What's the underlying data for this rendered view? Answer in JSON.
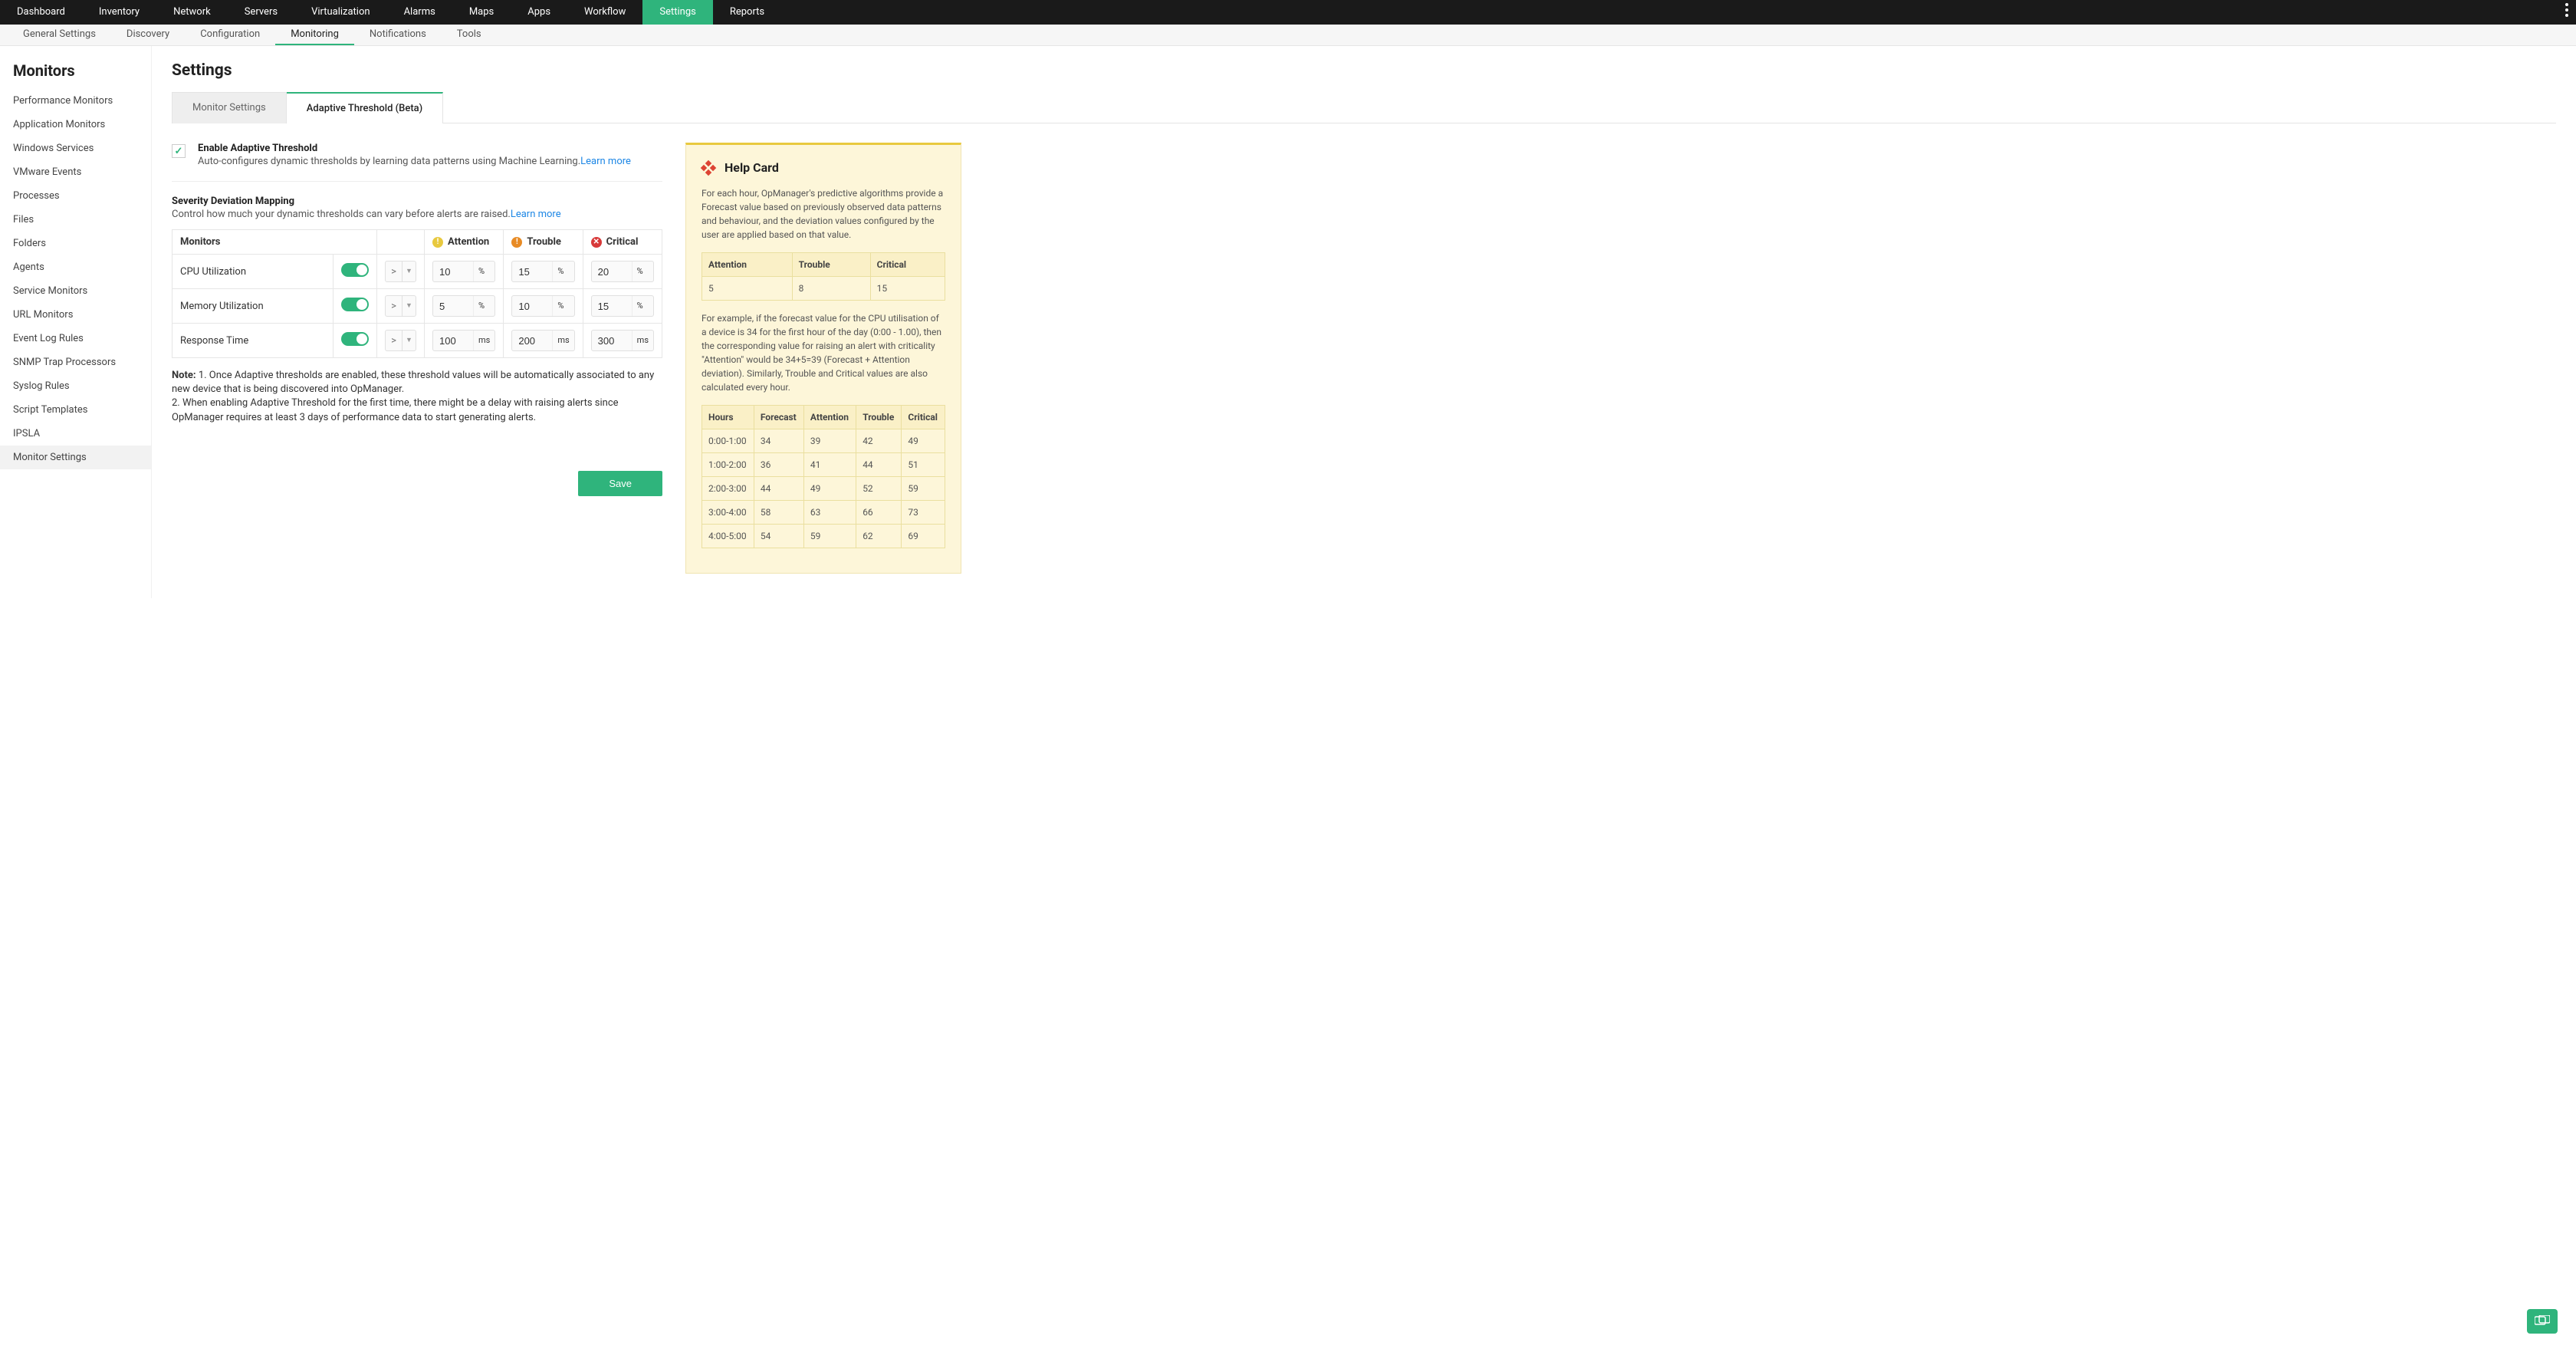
{
  "topnav": {
    "items": [
      "Dashboard",
      "Inventory",
      "Network",
      "Servers",
      "Virtualization",
      "Alarms",
      "Maps",
      "Apps",
      "Workflow",
      "Settings",
      "Reports"
    ],
    "active": "Settings"
  },
  "subnav": {
    "items": [
      "General Settings",
      "Discovery",
      "Configuration",
      "Monitoring",
      "Notifications",
      "Tools"
    ],
    "active": "Monitoring"
  },
  "sidebar": {
    "title": "Monitors",
    "items": [
      "Performance Monitors",
      "Application Monitors",
      "Windows Services",
      "VMware Events",
      "Processes",
      "Files",
      "Folders",
      "Agents",
      "Service Monitors",
      "URL Monitors",
      "Event Log Rules",
      "SNMP Trap Processors",
      "Syslog Rules",
      "Script Templates",
      "IPSLA",
      "Monitor Settings"
    ],
    "active": "Monitor Settings"
  },
  "page": {
    "title": "Settings",
    "tabs": [
      {
        "label": "Monitor Settings",
        "active": false
      },
      {
        "label": "Adaptive Threshold (Beta)",
        "active": true
      }
    ]
  },
  "enable": {
    "checked": true,
    "title": "Enable Adaptive Threshold",
    "desc": "Auto-configures dynamic thresholds by learning data patterns using Machine Learning.",
    "learn": "Learn more"
  },
  "severity": {
    "title": "Severity Deviation Mapping",
    "desc": "Control how much your dynamic thresholds can vary before alerts are raised.",
    "learn": "Learn more",
    "headers": {
      "monitors": "Monitors",
      "attention": "Attention",
      "trouble": "Trouble",
      "critical": "Critical"
    },
    "rows": [
      {
        "name": "CPU Utilization",
        "enabled": true,
        "op": ">",
        "attention": "10",
        "trouble": "15",
        "critical": "20",
        "unit": "%"
      },
      {
        "name": "Memory Utilization",
        "enabled": true,
        "op": ">",
        "attention": "5",
        "trouble": "10",
        "critical": "15",
        "unit": "%"
      },
      {
        "name": "Response Time",
        "enabled": true,
        "op": ">",
        "attention": "100",
        "trouble": "200",
        "critical": "300",
        "unit": "ms"
      }
    ]
  },
  "note": {
    "label": "Note:",
    "line1": "1. Once Adaptive thresholds are enabled, these threshold values will be automatically associated to any new device that is being discovered into OpManager.",
    "line2": "2. When enabling Adaptive Threshold for the first time, there might be a delay with raising alerts since OpManager requires at least 3 days of performance data to start generating alerts."
  },
  "save_label": "Save",
  "help": {
    "title": "Help Card",
    "para1": "For each hour, OpManager's predictive algorithms provide a Forecast value based on previously observed data patterns and behaviour, and the deviation values configured by the user are applied based on that value.",
    "sev_headers": {
      "attention": "Attention",
      "trouble": "Trouble",
      "critical": "Critical"
    },
    "sev_row": {
      "attention": "5",
      "trouble": "8",
      "critical": "15"
    },
    "para2": "For example, if the forecast value for the CPU utilisation of a device is 34 for the first hour of the day (0:00 - 1.00), then the corresponding value for raising an alert with criticality \"Attention\" would be 34+5=39 (Forecast + Attention deviation). Similarly, Trouble and Critical values are also calculated every hour.",
    "hours_headers": {
      "hours": "Hours",
      "forecast": "Forecast",
      "attention": "Attention",
      "trouble": "Trouble",
      "critical": "Critical"
    },
    "hours_rows": [
      {
        "hours": "0:00-1:00",
        "forecast": "34",
        "attention": "39",
        "trouble": "42",
        "critical": "49"
      },
      {
        "hours": "1:00-2:00",
        "forecast": "36",
        "attention": "41",
        "trouble": "44",
        "critical": "51"
      },
      {
        "hours": "2:00-3:00",
        "forecast": "44",
        "attention": "49",
        "trouble": "52",
        "critical": "59"
      },
      {
        "hours": "3:00-4:00",
        "forecast": "58",
        "attention": "63",
        "trouble": "66",
        "critical": "73"
      },
      {
        "hours": "4:00-5:00",
        "forecast": "54",
        "attention": "59",
        "trouble": "62",
        "critical": "69"
      }
    ]
  }
}
